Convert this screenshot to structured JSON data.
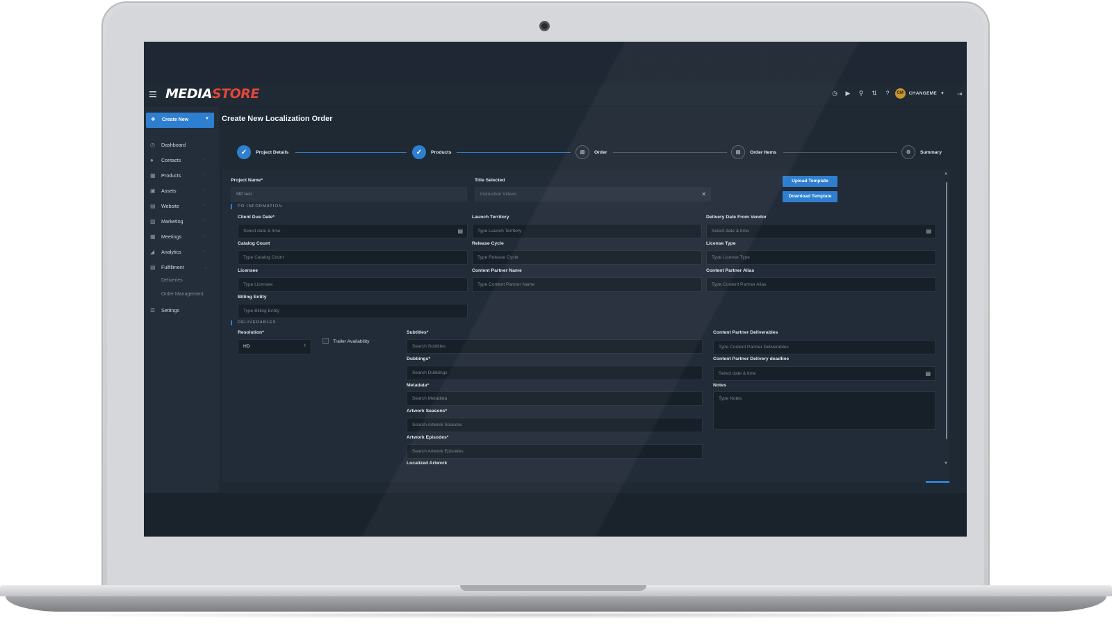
{
  "topbar": {
    "logo_a": "MEDIA",
    "logo_b": "STORE",
    "icons": [
      "clock-icon",
      "play-icon",
      "search-icon",
      "transfer-icon",
      "help-icon",
      "settings-icon"
    ],
    "user_initials": "CM",
    "user_name": "CHANGEME"
  },
  "sidebar": {
    "create_label": "Create New",
    "items": [
      {
        "label": "Dashboard",
        "icon": "dashboard-icon"
      },
      {
        "label": "Contacts",
        "icon": "contacts-icon"
      },
      {
        "label": "Products",
        "icon": "products-icon"
      },
      {
        "label": "Assets",
        "icon": "assets-icon"
      },
      {
        "label": "Website",
        "icon": "website-icon"
      },
      {
        "label": "Marketing",
        "icon": "marketing-icon"
      },
      {
        "label": "Meetings",
        "icon": "meetings-icon"
      },
      {
        "label": "Analytics",
        "icon": "analytics-icon"
      },
      {
        "label": "Fulfillment",
        "icon": "fulfillment-icon"
      }
    ],
    "sub_items": [
      "Deliveries",
      "Order Management"
    ],
    "settings_label": "Settings"
  },
  "main": {
    "title": "Create New Localization Order",
    "steps": [
      {
        "label": "Project Details",
        "status": "done"
      },
      {
        "label": "Products",
        "status": "done"
      },
      {
        "label": "Order",
        "status": "todo"
      },
      {
        "label": "Order Items",
        "status": "todo"
      },
      {
        "label": "Summary",
        "status": "todo"
      }
    ],
    "project_name_label": "Project Name*",
    "project_name_value": "MP test",
    "title_selected_label": "Title Selected",
    "title_selected_value": "Instruction Videos",
    "upload_template": "Upload Template",
    "download_template": "Download Template",
    "po_section": "PO INFORMATION",
    "client_due_label": "Client Due Date*",
    "client_due_ph": "Select date & time",
    "launch_territory_label": "Launch Territory",
    "launch_territory_ph": "Type Launch Territory",
    "delivery_vendor_label": "Delivery Date From Vendor",
    "delivery_vendor_ph": "Select date & time",
    "catalog_count_label": "Catalog Count",
    "catalog_count_ph": "Type Catalog Count",
    "release_cycle_label": "Release Cycle",
    "release_cycle_ph": "Type Release Cycle",
    "license_type_label": "License Type",
    "license_type_ph": "Type License Type",
    "licensee_label": "Licensee",
    "licensee_ph": "Type Licensee",
    "cp_name_label": "Content Partner Name",
    "cp_name_ph": "Type Content Partner Name",
    "cp_alias_label": "Content Partner Alias",
    "cp_alias_ph": "Type Content Partner Alias",
    "billing_label": "Billing Entity",
    "billing_ph": "Type Billing Entity",
    "deliverables_section": "DELIVERABLES",
    "resolution_label": "Resolution*",
    "resolution_value": "HD",
    "trailer_label": "Trailer Availability",
    "subtitles_label": "Subtitles*",
    "subtitles_ph": "Search Subtitles",
    "dubbings_label": "Dubbings*",
    "dubbings_ph": "Search Dubbings",
    "metadata_label": "Metadata*",
    "metadata_ph": "Search Metadata",
    "artwork_seasons_label": "Artwork Seasons*",
    "artwork_seasons_ph": "Search Artwork Seasons",
    "artwork_episodes_label": "Artwork Episodes*",
    "artwork_episodes_ph": "Search Artwork Episodes",
    "localized_artwork_label": "Localized Artwork",
    "cp_deliverables_label": "Content Partner Deliverables",
    "cp_deliverables_ph": "Type Content Partner Deliverables",
    "cp_deadline_label": "Content Partner Delivery deadline",
    "cp_deadline_ph": "Select date & time",
    "notes_label": "Notes",
    "notes_ph": "Type Notes"
  },
  "colors": {
    "accent": "#2f7fd0",
    "logo_red": "#e4463b",
    "background": "#1f2934"
  }
}
